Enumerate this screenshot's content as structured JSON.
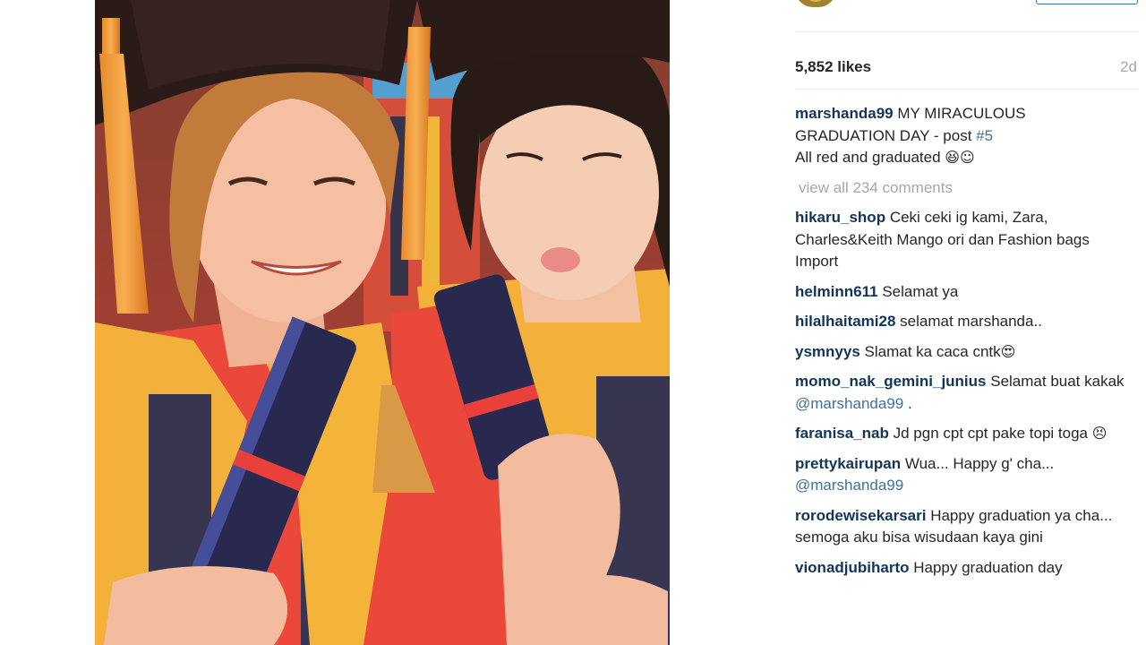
{
  "post": {
    "likes": "5,852 likes",
    "age": "2d",
    "caption": {
      "username": "marshanda99",
      "text_line1": "MY MIRACULOUS",
      "text_line2": "GRADUATION DAY - post ",
      "hashtag": "#5",
      "text_line3": "All red and graduated ",
      "emoji": "😆☺"
    },
    "view_all_comments": "view all 234 comments"
  },
  "comments": [
    {
      "username": "hikaru_shop",
      "text": "Ceki ceki ig kami, Zara, Charles&Keith Mango ori dan Fashion bags Import"
    },
    {
      "username": "helminn611",
      "text": "Selamat ya"
    },
    {
      "username": "hilalhaitami28",
      "text": "selamat marshanda.."
    },
    {
      "username": "ysmnyys",
      "text": "Slamat ka caca cntk",
      "emoji": "😍"
    },
    {
      "username": "momo_nak_gemini_junius",
      "text": "Selamat buat kakak ",
      "mention": "@marshanda99",
      "suffix": " ."
    },
    {
      "username": "faranisa_nab",
      "text": "Jd pgn cpt cpt pake topi toga ",
      "emoji": "😣"
    },
    {
      "username": "prettykairupan",
      "text": "Wua... Happy g' cha... ",
      "mention": "@marshanda99"
    },
    {
      "username": "rorodewisekarsari",
      "text": "Happy graduation ya cha... semoga aku bisa wisudaan kaya gini"
    },
    {
      "username": "vionadjubiharto",
      "text": "Happy graduation day"
    }
  ],
  "colors": {
    "username": "#12345a",
    "link": "#3f729b",
    "muted": "#a5a7aa",
    "text": "#262626"
  }
}
